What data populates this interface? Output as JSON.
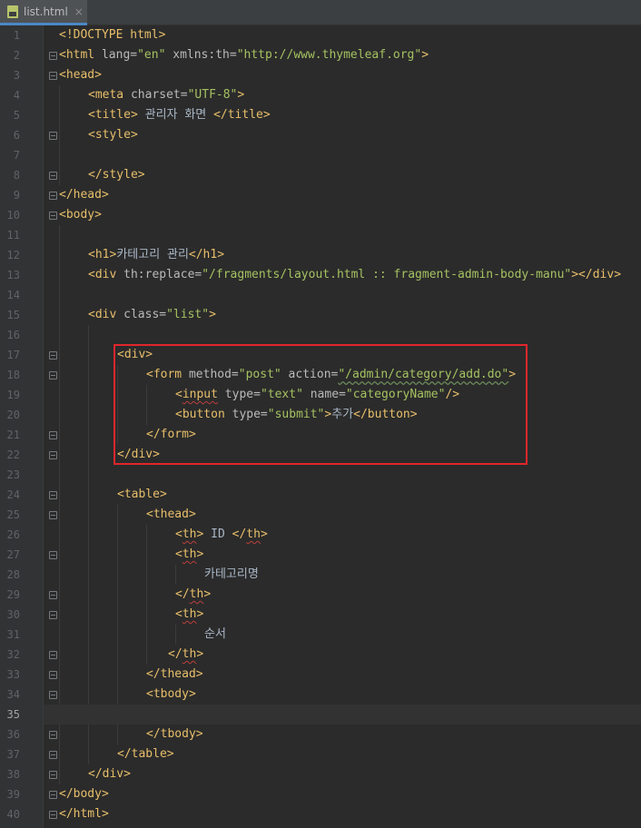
{
  "tab": {
    "filename": "list.html",
    "close": "×"
  },
  "colors": {
    "background": "#2b2b2b",
    "gutter": "#313335",
    "tag": "#e8bf6a",
    "attr": "#bababa",
    "value": "#a5c261",
    "text": "#a9b7c6",
    "highlight": "#e0262c"
  },
  "current_line": 35,
  "lines": [
    {
      "n": "1",
      "t": [
        [
          "doctype",
          "<!DOCTYPE html>"
        ]
      ]
    },
    {
      "n": "2",
      "t": [
        [
          "tag",
          "<html "
        ],
        [
          "attr",
          "lang="
        ],
        [
          "val",
          "\"en\""
        ],
        [
          "attr",
          " xmlns:th="
        ],
        [
          "val",
          "\"http://www.thymeleaf.org\""
        ],
        [
          "tag",
          ">"
        ]
      ]
    },
    {
      "n": "3",
      "t": [
        [
          "tag",
          "<head>"
        ]
      ]
    },
    {
      "n": "4",
      "t": [
        [
          "tag",
          "<meta "
        ],
        [
          "attr",
          "charset="
        ],
        [
          "val",
          "\"UTF-8\""
        ],
        [
          "tag",
          ">"
        ]
      ]
    },
    {
      "n": "5",
      "t": [
        [
          "tag",
          "<title>"
        ],
        [
          "txt",
          " 관리자 화면 "
        ],
        [
          "tag",
          "</title>"
        ]
      ]
    },
    {
      "n": "6",
      "t": [
        [
          "tag",
          "<style>"
        ]
      ]
    },
    {
      "n": "7",
      "t": []
    },
    {
      "n": "8",
      "t": [
        [
          "tag",
          "</style>"
        ]
      ]
    },
    {
      "n": "9",
      "t": [
        [
          "tag",
          "</head>"
        ]
      ]
    },
    {
      "n": "10",
      "t": [
        [
          "tag",
          "<body>"
        ]
      ]
    },
    {
      "n": "11",
      "t": []
    },
    {
      "n": "12",
      "t": [
        [
          "tag",
          "<h1>"
        ],
        [
          "txt",
          "카테고리 관리"
        ],
        [
          "tag",
          "</h1>"
        ]
      ]
    },
    {
      "n": "13",
      "t": [
        [
          "tag",
          "<div "
        ],
        [
          "attr",
          "th:replace="
        ],
        [
          "val",
          "\"/fragments/layout.html :: fragment-admin-body-manu\""
        ],
        [
          "tag",
          "></div>"
        ]
      ]
    },
    {
      "n": "14",
      "t": []
    },
    {
      "n": "15",
      "t": [
        [
          "tag",
          "<div "
        ],
        [
          "attr",
          "class="
        ],
        [
          "val",
          "\"list\""
        ],
        [
          "tag",
          ">"
        ]
      ]
    },
    {
      "n": "16",
      "t": []
    },
    {
      "n": "17",
      "t": [
        [
          "tag",
          "<div>"
        ]
      ]
    },
    {
      "n": "18",
      "t": [
        [
          "tag",
          "<form "
        ],
        [
          "attr",
          "method="
        ],
        [
          "val",
          "\"post\""
        ],
        [
          "attr",
          " action="
        ],
        [
          "val",
          "\"/admin/category/add.do\""
        ],
        [
          "tag",
          ">"
        ]
      ]
    },
    {
      "n": "19",
      "t": [
        [
          "tag",
          "<input "
        ],
        [
          "attr",
          "type="
        ],
        [
          "val",
          "\"text\""
        ],
        [
          "attr",
          " name="
        ],
        [
          "val",
          "\"categoryName\""
        ],
        [
          "tag",
          "/>"
        ]
      ]
    },
    {
      "n": "20",
      "t": [
        [
          "tag",
          "<button "
        ],
        [
          "attr",
          "type="
        ],
        [
          "val",
          "\"submit\""
        ],
        [
          "tag",
          ">"
        ],
        [
          "txt",
          "추가"
        ],
        [
          "tag",
          "</button>"
        ]
      ]
    },
    {
      "n": "21",
      "t": [
        [
          "tag",
          "</form>"
        ]
      ]
    },
    {
      "n": "22",
      "t": [
        [
          "tag",
          "</div>"
        ]
      ]
    },
    {
      "n": "23",
      "t": []
    },
    {
      "n": "24",
      "t": [
        [
          "tag",
          "<table>"
        ]
      ]
    },
    {
      "n": "25",
      "t": [
        [
          "tag",
          "<thead>"
        ]
      ]
    },
    {
      "n": "26",
      "t": [
        [
          "tag",
          "<th>"
        ],
        [
          "txt",
          " ID "
        ],
        [
          "tag",
          "</th>"
        ]
      ]
    },
    {
      "n": "27",
      "t": [
        [
          "tag",
          "<th>"
        ]
      ]
    },
    {
      "n": "28",
      "t": [
        [
          "txt",
          "카테고리명"
        ]
      ]
    },
    {
      "n": "29",
      "t": [
        [
          "tag",
          "</th>"
        ]
      ]
    },
    {
      "n": "30",
      "t": [
        [
          "tag",
          "<th>"
        ]
      ]
    },
    {
      "n": "31",
      "t": [
        [
          "txt",
          "순서"
        ]
      ]
    },
    {
      "n": "32",
      "t": [
        [
          "tag",
          "</th>"
        ]
      ]
    },
    {
      "n": "33",
      "t": [
        [
          "tag",
          "</thead>"
        ]
      ]
    },
    {
      "n": "34",
      "t": [
        [
          "tag",
          "<tbody>"
        ]
      ]
    },
    {
      "n": "35",
      "t": []
    },
    {
      "n": "36",
      "t": [
        [
          "tag",
          "</tbody>"
        ]
      ]
    },
    {
      "n": "37",
      "t": [
        [
          "tag",
          "</table>"
        ]
      ]
    },
    {
      "n": "38",
      "t": [
        [
          "tag",
          "</div>"
        ]
      ]
    },
    {
      "n": "39",
      "t": [
        [
          "tag",
          "</body>"
        ]
      ]
    },
    {
      "n": "40",
      "t": [
        [
          "tag",
          "</html>"
        ]
      ]
    }
  ]
}
